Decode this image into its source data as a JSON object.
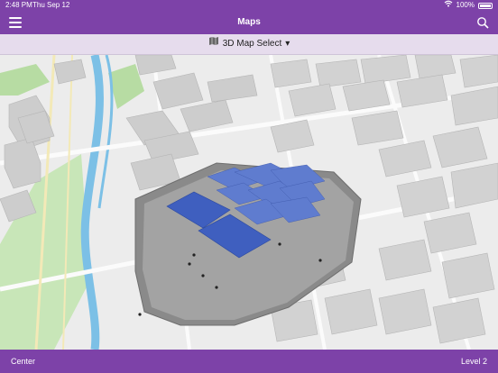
{
  "status": {
    "time": "2:48 PM",
    "date": "Thu Sep 12",
    "battery": "100%"
  },
  "nav": {
    "title": "Maps",
    "menu_icon": "hamburger-menu-icon",
    "search_icon": "search-icon"
  },
  "map_select": {
    "label": "3D Map Select",
    "caret": "▾",
    "icon": "map-icon"
  },
  "footer": {
    "left": "Center",
    "right": "Level 2"
  },
  "colors": {
    "brand": "#7d42a8",
    "select_bar": "#e6dced",
    "building": "#c9c9c9",
    "water": "#7cc0e6",
    "park": "#b7dca3",
    "venue_blue": "#3f5fbf"
  }
}
